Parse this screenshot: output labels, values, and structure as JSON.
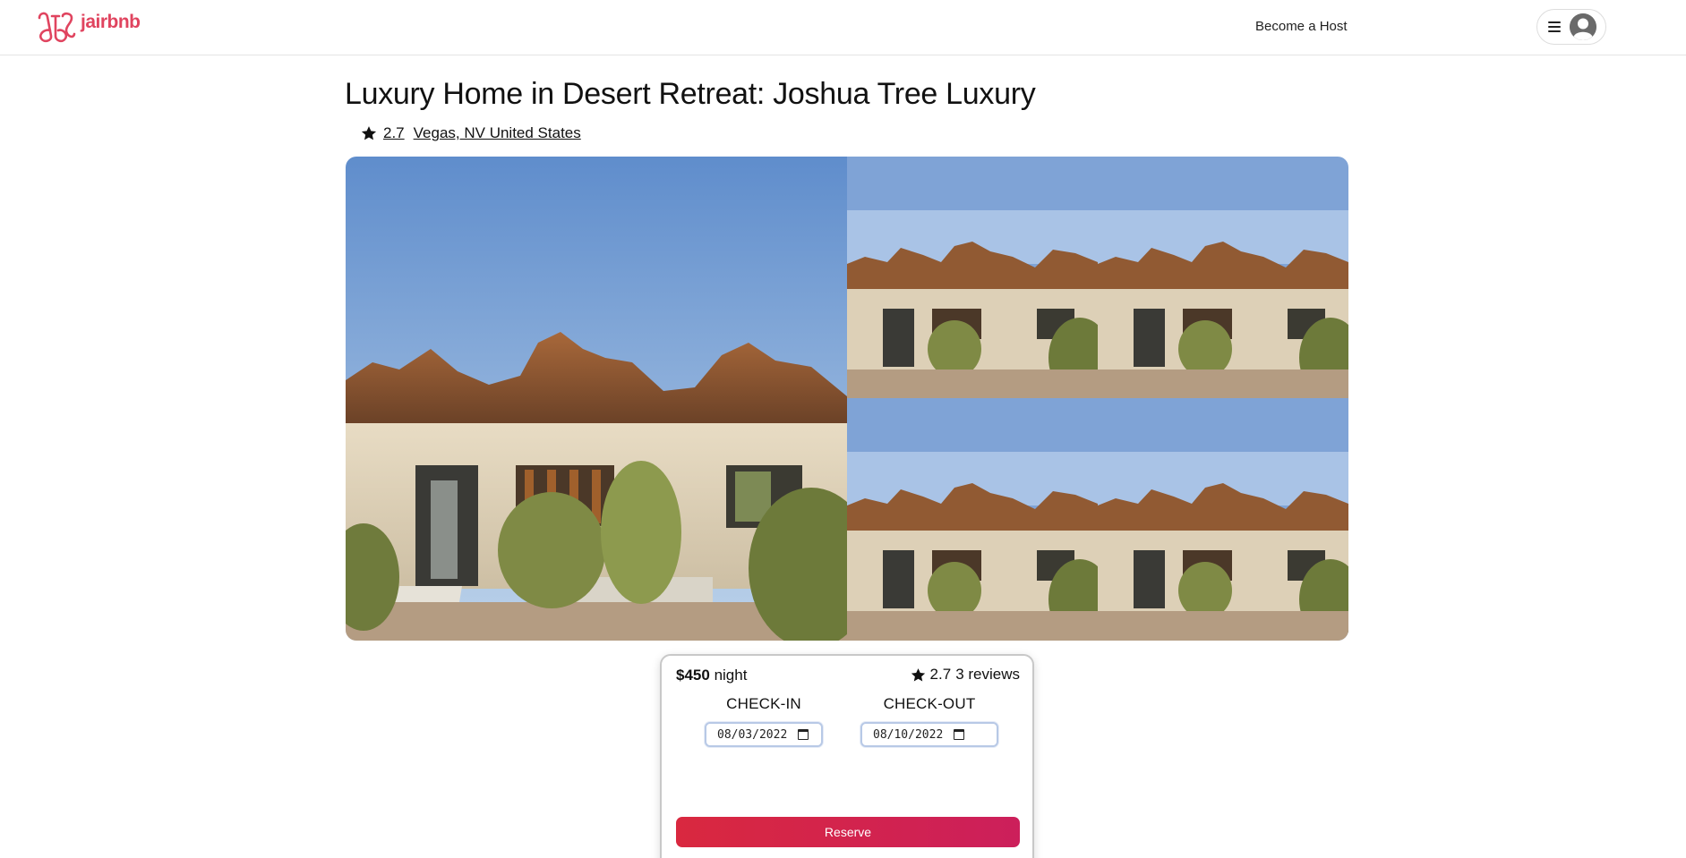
{
  "header": {
    "brand": "jairbnb",
    "host_link": "Become a Host"
  },
  "listing": {
    "title": "Luxury Home in Desert Retreat: Joshua Tree Luxury",
    "rating": "2.7",
    "location": "Vegas, NV United States"
  },
  "booking": {
    "price": "$450",
    "price_unit": "night",
    "rating": "2.7",
    "reviews": "3 reviews",
    "checkin_label": "CHECK-IN",
    "checkout_label": "CHECK-OUT",
    "checkin_value": "08/03/2022",
    "checkout_value": "08/10/2022",
    "reserve_label": "Reserve"
  },
  "icons": {
    "logo": "jairbnb-logo-icon",
    "star": "star-icon",
    "menu": "hamburger-icon",
    "avatar": "user-avatar-icon",
    "calendar": "calendar-icon"
  },
  "colors": {
    "brand": "#e0445f",
    "reserve_start": "#d9283f",
    "reserve_end": "#cc1f5b"
  }
}
